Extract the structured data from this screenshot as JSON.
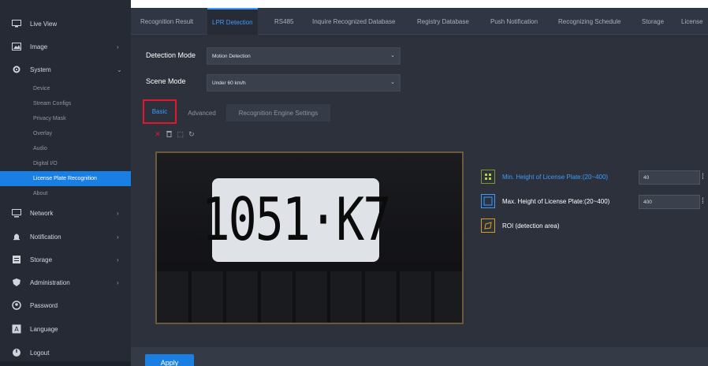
{
  "sidebar": {
    "items": [
      {
        "label": "Live View",
        "icon": "monitor-icon"
      },
      {
        "label": "Image",
        "icon": "image-icon",
        "chevron": "›"
      },
      {
        "label": "System",
        "icon": "gear-icon",
        "chevron": "⌄"
      },
      {
        "label": "Network",
        "icon": "network-icon",
        "chevron": "›"
      },
      {
        "label": "Notification",
        "icon": "bell-icon",
        "chevron": "›"
      },
      {
        "label": "Storage",
        "icon": "storage-icon",
        "chevron": "›"
      },
      {
        "label": "Administration",
        "icon": "shield-icon",
        "chevron": "›"
      },
      {
        "label": "Password",
        "icon": "user-icon"
      },
      {
        "label": "Language",
        "icon": "language-icon"
      },
      {
        "label": "Logout",
        "icon": "power-icon"
      }
    ],
    "system_subitems": [
      "Device",
      "Stream Configs",
      "Privacy Mask",
      "Overlay",
      "Audio",
      "Digital I/O",
      "License Plate Recognition",
      "About"
    ],
    "active_subitem": "License Plate Recognition"
  },
  "tabs": [
    "Recognition Result",
    "LPR Detection",
    "RS485",
    "Inquire Recognized Database",
    "Registry Database",
    "Push Notification",
    "Recognizing Schedule",
    "Storage",
    "License"
  ],
  "active_tab": "LPR Detection",
  "form": {
    "detection_mode_label": "Detection Mode",
    "detection_mode_value": "Motion Detection",
    "scene_mode_label": "Scene Mode",
    "scene_mode_value": "Under 60 km/h"
  },
  "subtabs": [
    "Basic",
    "Advanced",
    "Recognition Engine Settings"
  ],
  "active_subtab": "Basic",
  "tools": {
    "delete": "✕",
    "trash": "🗑",
    "select": "⬚",
    "refresh": "↻"
  },
  "video": {
    "plate_text": "1051·K7"
  },
  "roi": {
    "min_label": "Min. Height of License Plate:(20~400)",
    "min_value": "40",
    "max_label": "Max. Height of License Plate:(20~400)",
    "max_value": "400",
    "roi_label": "ROI (detection area)"
  },
  "apply_label": "Apply",
  "colors": {
    "accent": "#1a7fe3",
    "highlight_border": "#e0182d",
    "roi_icon": "#d4a020"
  }
}
